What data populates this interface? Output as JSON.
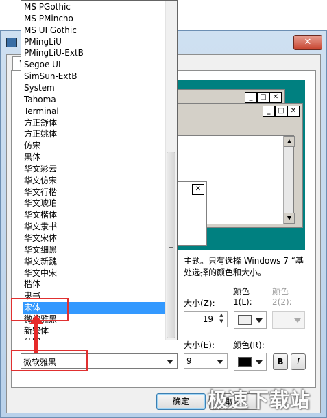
{
  "dialog": {
    "tab_label": "窗",
    "close_glyph": "✕",
    "info_line1": "主题。只有选择 Windows 7 “基",
    "info_line2": "处选择的颜色和大小。",
    "size1_label": "大小(Z):",
    "size1_value": "19",
    "color1_label": "颜色",
    "color1_sub": "1(L):",
    "color2_label": "颜色",
    "color2_sub": "2(2):",
    "size2_label": "大小(E):",
    "size2_value": "9",
    "color3_label": "颜色(R):",
    "bold_label": "B",
    "italic_label": "I",
    "ok_label": "确定",
    "cancel_label": "取消"
  },
  "preview": {
    "min_glyph": "_",
    "max_glyph": "□",
    "close_glyph": "✕"
  },
  "font_list": {
    "items": [
      "MS PGothic",
      "MS PMincho",
      "MS UI Gothic",
      "PMingLiU",
      "PMingLiU-ExtB",
      "Segoe UI",
      "SimSun-ExtB",
      "System",
      "Tahoma",
      "Terminal",
      "方正舒体",
      "方正姚体",
      "仿宋",
      "黑体",
      "华文彩云",
      "华文仿宋",
      "华文行楷",
      "华文琥珀",
      "华文楷体",
      "华文隶书",
      "华文宋体",
      "华文细黑",
      "华文新魏",
      "华文中宋",
      "楷体",
      "隶书",
      "宋体",
      "微软雅黑",
      "新宋体",
      "幼圆"
    ],
    "selected_index": 26,
    "current_value": "微软雅黑"
  },
  "watermark": "极速下载站",
  "colors": {
    "selection": "#3399ff",
    "annotation": "#e03030",
    "preview_bg": "#008080"
  }
}
